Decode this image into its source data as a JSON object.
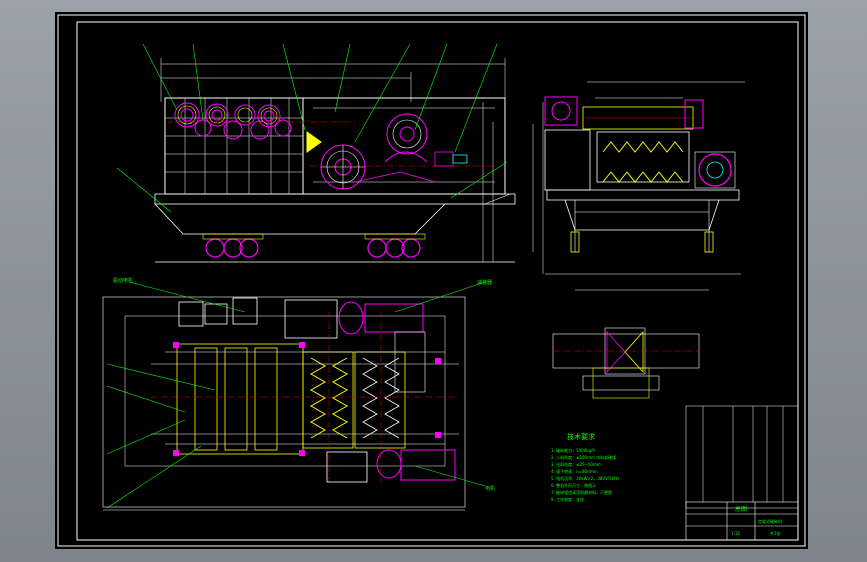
{
  "drawing": {
    "sheet_border_color": "#ffffff",
    "background": "#000000",
    "colors": {
      "frame": "#ffffff",
      "outline": "#ffff00",
      "dimension": "#ffffff",
      "leader": "#00ff00",
      "center": "#ff0000",
      "highlight": "#ff00ff",
      "detail": "#00ffff"
    }
  },
  "notes": {
    "heading": "技术要求",
    "items": [
      "1. 破碎能力：5000kg/h",
      "2. 入料粒度：≤100mm 块料或硬煤",
      "3. 出料粒度：≤25~50mm",
      "4. 辊子转速：n=80r/min",
      "5. 电机功率：30kW×2，380V/50Hz",
      "6. 整机外形尺寸：按图示",
      "7. 破碎辊齿采用耐磨材料，可更换",
      "8. 工作制度：连续"
    ]
  },
  "callouts": {
    "plan_left_top": "驱动电机",
    "plan_right_top": "减速器",
    "plan_right_bottom": "电机"
  },
  "title_block": {
    "main_title": "总图",
    "drawing_name": "齿辊式破碎机",
    "scale": "1:10",
    "sheet": "共1张"
  }
}
